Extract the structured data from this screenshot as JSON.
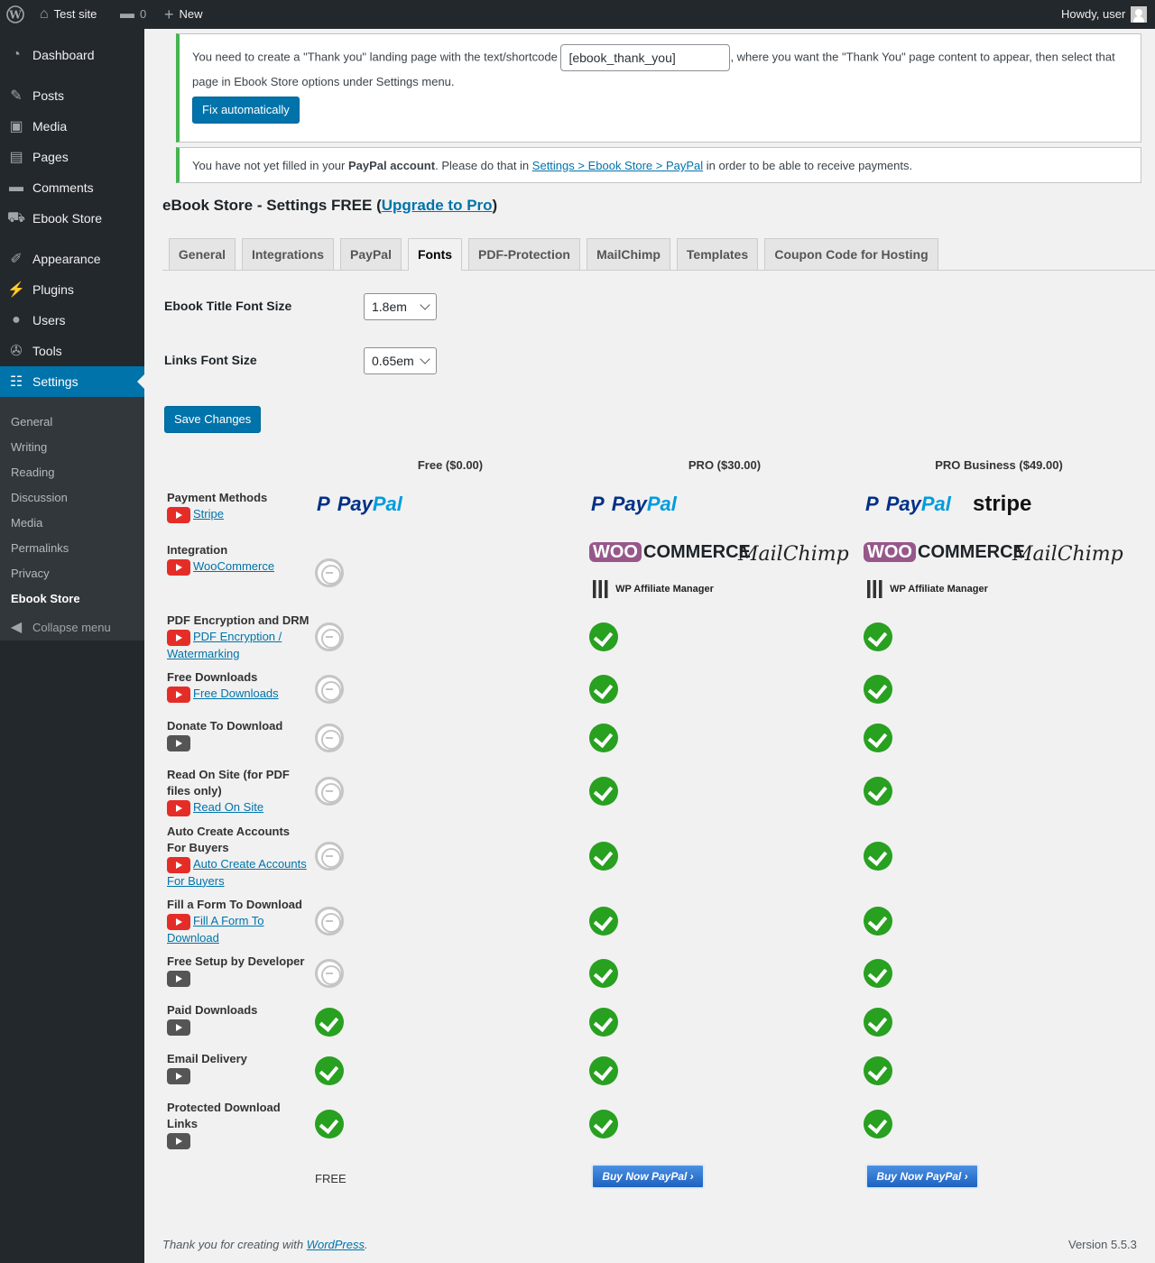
{
  "adminbar": {
    "site_name": "Test site",
    "comments_count": "0",
    "new_label": "New",
    "greeting": "Howdy, user"
  },
  "sidebar": {
    "items": [
      {
        "label": "Dashboard",
        "icon": "dashboard-icon"
      },
      {
        "label": "Posts",
        "icon": "pin-icon"
      },
      {
        "label": "Media",
        "icon": "media-icon"
      },
      {
        "label": "Pages",
        "icon": "pages-icon"
      },
      {
        "label": "Comments",
        "icon": "comment-icon"
      },
      {
        "label": "Ebook Store",
        "icon": "cart-icon"
      },
      {
        "label": "Appearance",
        "icon": "brush-icon"
      },
      {
        "label": "Plugins",
        "icon": "plugin-icon"
      },
      {
        "label": "Users",
        "icon": "user-icon"
      },
      {
        "label": "Tools",
        "icon": "wrench-icon"
      },
      {
        "label": "Settings",
        "icon": "settings-icon"
      }
    ],
    "submenu": [
      "General",
      "Writing",
      "Reading",
      "Discussion",
      "Media",
      "Permalinks",
      "Privacy",
      "Ebook Store"
    ],
    "collapse_label": "Collapse menu"
  },
  "notices": {
    "thank_you_before": "You need to create a \"Thank you\" landing page with the text/shortcode",
    "thank_you_shortcode": "[ebook_thank_you]",
    "thank_you_after": ", where you want the \"Thank You\" page content to appear, then select that",
    "thank_you_line2": "page in Ebook Store options under Settings menu.",
    "fix_button": "Fix automatically",
    "paypal_before": "You have not yet filled in your",
    "paypal_bold": "PayPal account",
    "paypal_middle": ". Please do that in",
    "paypal_link": "Settings > Ebook Store > PayPal",
    "paypal_after": "in order to be able to receive payments."
  },
  "page": {
    "title_prefix": "eBook Store - Settings FREE (",
    "upgrade_link": "Upgrade to Pro",
    "title_suffix": ")"
  },
  "tabs": [
    "General",
    "Integrations",
    "PayPal",
    "Fonts",
    "PDF-Protection",
    "MailChimp",
    "Templates",
    "Coupon Code for Hosting"
  ],
  "active_tab": "Fonts",
  "form": {
    "title_font_label": "Ebook Title Font Size",
    "title_font_value": "1.8em",
    "links_font_label": "Links Font Size",
    "links_font_value": "0.65em",
    "save_button": "Save Changes"
  },
  "comparison": {
    "plans": [
      "Free ($0.00)",
      "PRO ($30.00)",
      "PRO Business ($49.00)"
    ],
    "logos": {
      "paypal_pay": "Pay",
      "paypal_pal": "Pal",
      "stripe": "stripe",
      "woo": "WOO",
      "commerce": "COMMERCE",
      "mailchimp": "MailChimp",
      "wp_affiliate": "WP Affiliate Manager"
    },
    "rows": [
      {
        "label": "Payment Methods",
        "link": "Stripe"
      },
      {
        "label": "Integration",
        "link": "WooCommerce"
      },
      {
        "label": "PDF Encryption and DRM",
        "link": "PDF Encryption / Watermarking"
      },
      {
        "label": "Free Downloads",
        "link": "Free Downloads"
      },
      {
        "label": "Donate To Download",
        "link": ""
      },
      {
        "label": "Read On Site (for PDF files only)",
        "link": "Read On Site"
      },
      {
        "label": "Auto Create Accounts For Buyers",
        "link": "Auto Create Accounts For Buyers"
      },
      {
        "label": "Fill a Form To Download",
        "link": "Fill A Form To Download"
      },
      {
        "label": "Free Setup by Developer",
        "link": ""
      },
      {
        "label": "Paid Downloads",
        "link": ""
      },
      {
        "label": "Email Delivery",
        "link": ""
      },
      {
        "label": "Protected Download Links",
        "link": ""
      }
    ],
    "free_label": "FREE",
    "buy_button": "Buy Now PayPal ›"
  },
  "footer": {
    "thanks_prefix": "Thank you for creating with",
    "wordpress_link": "WordPress",
    "thanks_suffix": ".",
    "version": "Version 5.5.3"
  }
}
